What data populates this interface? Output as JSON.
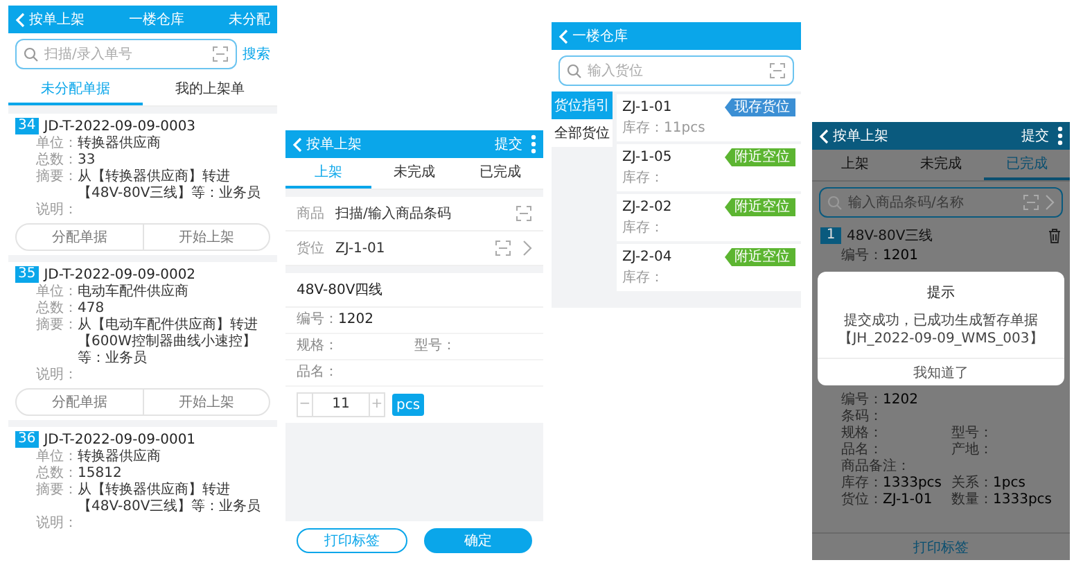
{
  "list_screen": {
    "header": {
      "back_label": "按单上架",
      "title": "一楼仓库",
      "action": "未分配"
    },
    "search": {
      "placeholder": "扫描/录入单号",
      "button": "搜索"
    },
    "tabs": [
      {
        "label": "未分配单据",
        "selected": true
      },
      {
        "label": "我的上架单",
        "selected": false
      }
    ],
    "cards": [
      {
        "index": "34",
        "number": "JD-T-2022-09-09-0003",
        "fields": [
          {
            "label": "单位：",
            "value": "转换器供应商"
          },
          {
            "label": "总数：",
            "value": "33"
          },
          {
            "label": "摘要：",
            "value": "从【转换器供应商】转进【48V-80V三线】等：业务员"
          },
          {
            "label": "说明："
          }
        ],
        "actions": [
          "分配单据",
          "开始上架"
        ]
      },
      {
        "index": "35",
        "number": "JD-T-2022-09-09-0002",
        "fields": [
          {
            "label": "单位：",
            "value": "电动车配件供应商"
          },
          {
            "label": "总数：",
            "value": "478"
          },
          {
            "label": "摘要：",
            "value": "从【电动车配件供应商】转进【600W控制器曲线小速控】等：业务员"
          },
          {
            "label": "说明："
          }
        ],
        "actions": [
          "分配单据",
          "开始上架"
        ]
      },
      {
        "index": "36",
        "number": "JD-T-2022-09-09-0001",
        "fields": [
          {
            "label": "单位：",
            "value": "转换器供应商"
          },
          {
            "label": "总数：",
            "value": "15812"
          },
          {
            "label": "摘要：",
            "value": "从【转换器供应商】转进【48V-80V三线】等：业务员"
          },
          {
            "label": "说明："
          }
        ]
      }
    ]
  },
  "shelving_screen": {
    "header": {
      "back_label": "按单上架",
      "action": "提交"
    },
    "tabs": [
      {
        "label": "上架",
        "selected": true
      },
      {
        "label": "未完成",
        "selected": false
      },
      {
        "label": "已完成",
        "selected": false
      }
    ],
    "inputs": [
      {
        "label": "商品",
        "placeholder": "扫描/输入商品条码",
        "chevron": false
      },
      {
        "label": "货位",
        "value": "ZJ-1-01",
        "chevron": true
      }
    ],
    "product": {
      "name": "48V-80V四线",
      "rows": [
        [
          {
            "label": "编号：",
            "value": "1202"
          }
        ],
        [
          {
            "label": "规格："
          },
          {
            "label": "型号："
          }
        ],
        [
          {
            "label": "品名："
          }
        ]
      ]
    },
    "stepper": {
      "minus": "−",
      "value": "11",
      "plus": "+",
      "unit": "pcs"
    },
    "buttons": [
      {
        "label": "打印标签",
        "kind": "outline"
      },
      {
        "label": "确定",
        "kind": "primary"
      }
    ]
  },
  "location_screen": {
    "header": {
      "title": "一楼仓库"
    },
    "search": {
      "placeholder": "输入货位"
    },
    "nav": [
      {
        "label": "货位指引",
        "selected": true
      },
      {
        "label": "全部货位",
        "selected": false
      }
    ],
    "locations": [
      {
        "code": "ZJ-1-01",
        "stock_label": "库存：",
        "stock": "11pcs",
        "tag": "现存货位",
        "color": "#3b8fd4"
      },
      {
        "code": "ZJ-1-05",
        "stock_label": "库存：",
        "tag": "附近空位",
        "color": "#5cb531"
      },
      {
        "code": "ZJ-2-02",
        "stock_label": "库存：",
        "tag": "附近空位",
        "color": "#5cb531"
      },
      {
        "code": "ZJ-2-04",
        "stock_label": "库存：",
        "tag": "附近空位",
        "color": "#5cb531"
      }
    ]
  },
  "completed_screen": {
    "header": {
      "back_label": "按单上架",
      "action": "提交"
    },
    "tabs": [
      {
        "label": "上架",
        "selected": false
      },
      {
        "label": "未完成",
        "selected": false
      },
      {
        "label": "已完成",
        "selected": true
      }
    ],
    "search": {
      "placeholder": "输入商品条码/名称"
    },
    "items": [
      {
        "index": "1",
        "name": "48V-80V三线",
        "rows": [
          [
            {
              "label": "编号：",
              "value": "1201"
            }
          ]
        ]
      },
      {
        "rows": [
          [
            {
              "label": "编号：",
              "value": "1202"
            }
          ],
          [
            {
              "label": "条码："
            }
          ],
          [
            {
              "label": "规格："
            },
            {
              "label": "型号："
            }
          ],
          [
            {
              "label": "品名："
            },
            {
              "label": "产地："
            }
          ],
          [
            {
              "label": "商品备注："
            }
          ],
          [
            {
              "label": "库存：",
              "value": "1333pcs"
            },
            {
              "label": "关系：",
              "value": "1pcs"
            }
          ],
          [
            {
              "label": "货位：",
              "value": "ZJ-1-01"
            },
            {
              "label": "数量：",
              "value": "1333pcs"
            }
          ]
        ]
      }
    ],
    "dialog": {
      "title": "提示",
      "message_lines": [
        "提交成功，已成功生成暂存单据",
        "【JH_2022-09-09_WMS_003】"
      ],
      "button": "我知道了"
    },
    "footer_button": "打印标签"
  }
}
